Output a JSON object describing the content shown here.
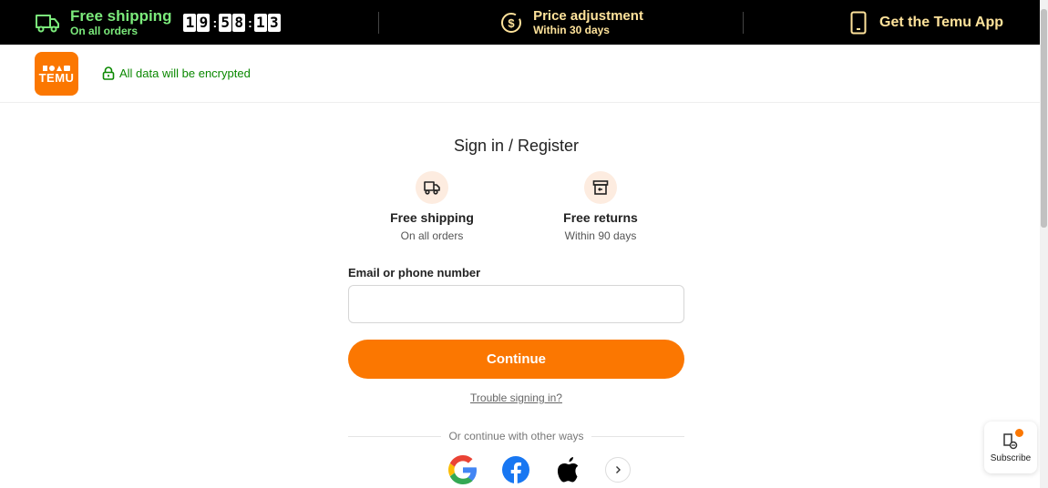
{
  "topbar": {
    "shipping": {
      "title": "Free shipping",
      "subtitle": "On all orders",
      "icon": "truck-icon"
    },
    "timer": {
      "d1": "1",
      "d2": "9",
      "d3": "5",
      "d4": "8",
      "d5": "1",
      "d6": "3"
    },
    "price": {
      "title": "Price adjustment",
      "subtitle": "Within 30 days",
      "icon": "dollar-icon"
    },
    "app": {
      "label": "Get the Temu App",
      "icon": "phone-icon"
    },
    "colors": {
      "ship": "#7bea7b",
      "accent": "#ffe39b"
    }
  },
  "header": {
    "logo_text": "TEMU",
    "secure_text": "All data will be encrypted",
    "secure_color": "#0a8800"
  },
  "main": {
    "title": "Sign in / Register",
    "benefits": [
      {
        "title": "Free shipping",
        "subtitle": "On all orders",
        "icon": "truck-icon"
      },
      {
        "title": "Free returns",
        "subtitle": "Within 90 days",
        "icon": "return-box-icon"
      }
    ],
    "email_label": "Email or phone number",
    "email_value": "",
    "continue_label": "Continue",
    "trouble_label": "Trouble signing in?",
    "or_text": "Or continue with other ways",
    "socials": [
      "google-icon",
      "facebook-icon",
      "apple-icon"
    ],
    "brand_color": "#fb7701"
  },
  "subscribe": {
    "label": "Subscribe"
  }
}
